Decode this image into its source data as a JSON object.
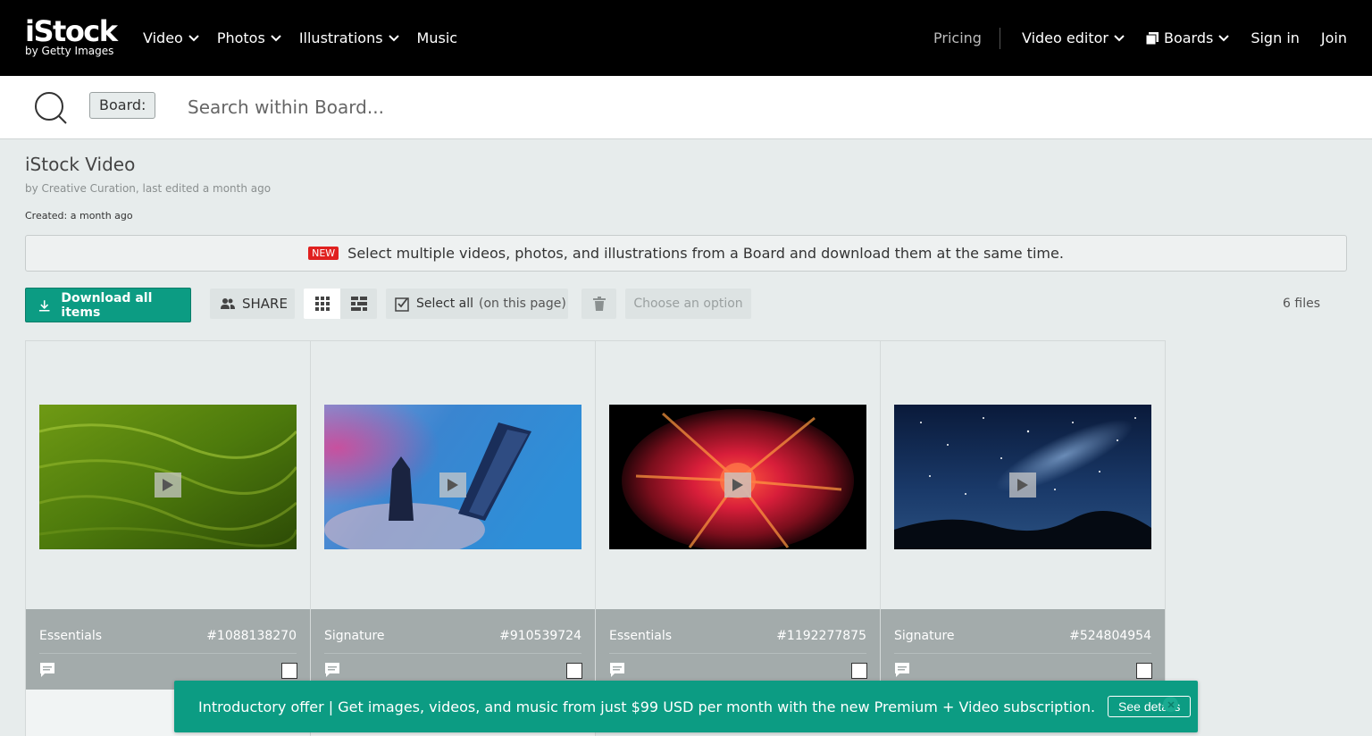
{
  "header": {
    "logo_main": "iStock",
    "logo_sub": "by Getty Images",
    "nav_left": [
      {
        "label": "Video"
      },
      {
        "label": "Photos"
      },
      {
        "label": "Illustrations"
      },
      {
        "label": "Music"
      }
    ],
    "pricing": "Pricing",
    "video_editor": "Video editor",
    "boards": "Boards",
    "sign_in": "Sign in",
    "join": "Join"
  },
  "search": {
    "chip": "Board:",
    "placeholder": "Search within Board..."
  },
  "board": {
    "title": "iStock Video",
    "meta": "by Creative Curation, last edited a month ago",
    "created": "Created: a month ago"
  },
  "notice": {
    "badge": "NEW",
    "text": "Select multiple videos, photos, and illustrations from a Board and download them at the same time."
  },
  "toolbar": {
    "download_label": "Download all items",
    "share_label": "SHARE",
    "select_all": "Select all",
    "select_all_suffix": "(on this page)",
    "choose_option": "Choose an option",
    "files_count": "6 files"
  },
  "cards": [
    {
      "collection": "Essentials",
      "id": "#1088138270",
      "thumb": "grass"
    },
    {
      "collection": "Signature",
      "id": "#910539724",
      "thumb": "towers"
    },
    {
      "collection": "Essentials",
      "id": "#1192277875",
      "thumb": "explosion"
    },
    {
      "collection": "Signature",
      "id": "#524804954",
      "thumb": "stars"
    }
  ],
  "promo": {
    "text": "Introductory offer | Get images, videos, and music from just $99 USD per month with the new Premium + Video subscription.",
    "button": "See details"
  },
  "colors": {
    "accent": "#0c9c83",
    "header_bg": "#000000",
    "new_badge": "#e0201f"
  }
}
